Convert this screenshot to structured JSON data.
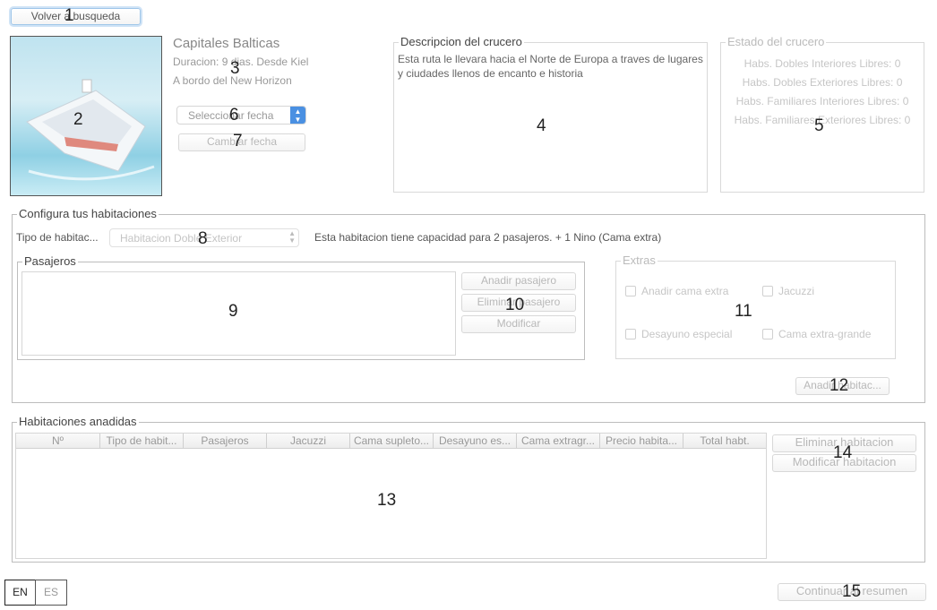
{
  "nav": {
    "back_label": "Volver a busqueda"
  },
  "cruise": {
    "name": "Capitales Balticas",
    "duration": "Duracion: 9 dias. Desde Kiel",
    "ship": "A bordo del New Horizon",
    "date_select": "Seleccionar fecha",
    "change_date": "Cambiar fecha"
  },
  "description": {
    "legend": "Descripcion del crucero",
    "text": "Esta ruta le llevara hacia el Norte de Europa a traves de lugares y ciudades llenos de encanto e historia"
  },
  "status": {
    "legend": "Estado del crucero",
    "items": [
      "Habs. Dobles Interiores Libres: 0",
      "Habs. Dobles Exteriores Libres: 0",
      "Habs. Familiares Interiores Libres: 0",
      "Habs. Familiares Exteriores Libres: 0"
    ]
  },
  "config": {
    "legend": "Configura tus habitaciones",
    "room_type_label": "Tipo de habitac...",
    "room_type_value": "Habitacion Doble Exterior",
    "capacity_text": "Esta habitacion tiene capacidad para 2 pasajeros. + 1 Nino (Cama extra)",
    "passengers": {
      "legend": "Pasajeros",
      "add": "Anadir pasajero",
      "remove": "Eliminar pasajero",
      "modify": "Modificar"
    },
    "extras": {
      "legend": "Extras",
      "extra_bed": "Anadir cama extra",
      "jacuzzi": "Jacuzzi",
      "breakfast": "Desayuno especial",
      "big_bed": "Cama extra-grande"
    },
    "add_room": "Anadir habitac..."
  },
  "added_rooms": {
    "legend": "Habitaciones anadidas",
    "columns": [
      "Nº",
      "Tipo de habit...",
      "Pasajeros",
      "Jacuzzi",
      "Cama supleto...",
      "Desayuno es...",
      "Cama extragr...",
      "Precio habita...",
      "Total habt."
    ],
    "remove": "Eliminar habitacion",
    "modify": "Modificar habitacion"
  },
  "lang": {
    "en": "EN",
    "es": "ES"
  },
  "footer": {
    "continue": "Continuar al resumen"
  },
  "markers": [
    "1",
    "2",
    "3",
    "4",
    "5",
    "6",
    "7",
    "8",
    "9",
    "10",
    "11",
    "12",
    "13",
    "14",
    "15"
  ],
  "colors": {
    "sea_top": "#9fd3e6",
    "sea_bottom": "#e9f6fa",
    "focus": "#9fc6e9",
    "stepper": "#4a90e2"
  }
}
